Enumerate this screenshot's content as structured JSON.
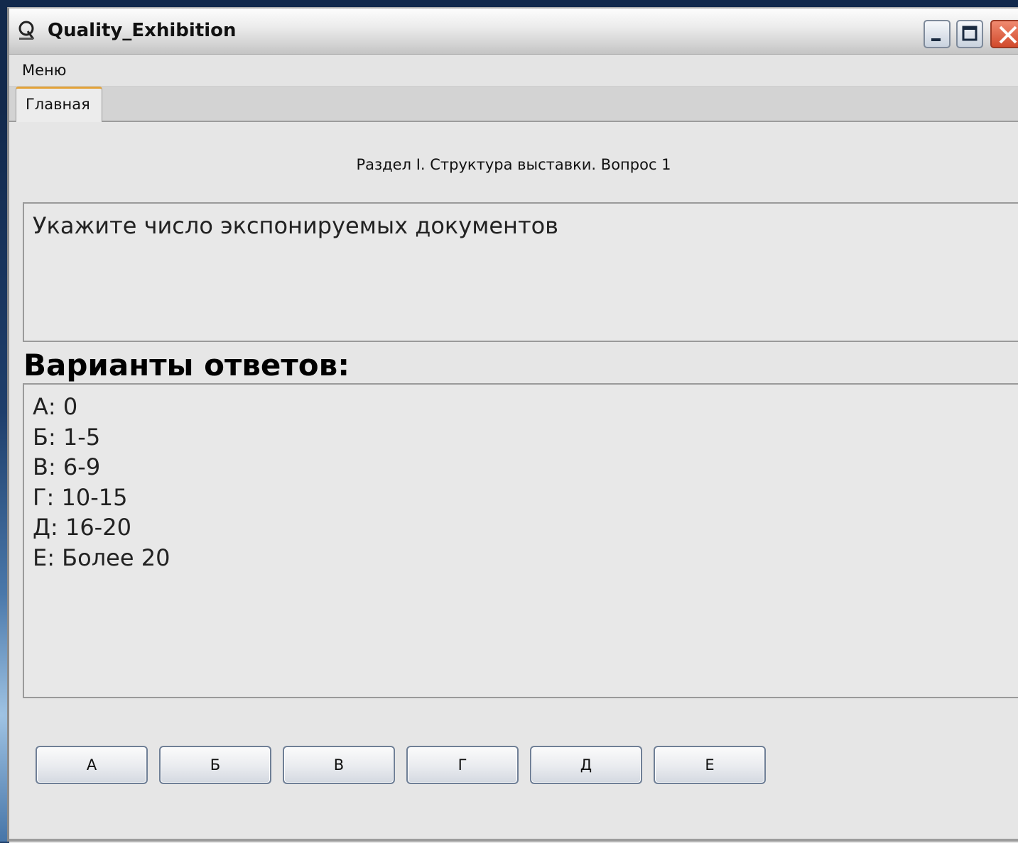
{
  "window": {
    "title": "Quality_Exhibition"
  },
  "menubar": {
    "items": [
      {
        "label": "Меню"
      }
    ]
  },
  "tabs": [
    {
      "label": "Главная",
      "active": true
    }
  ],
  "main": {
    "section_title": "Раздел I. Структура выставки. Вопрос 1",
    "question": "Укажите число экспонируемых документов",
    "answers_heading": "Варианты ответов:",
    "answers": [
      "А: 0",
      "Б: 1-5",
      "В: 6-9",
      "Г: 10-15",
      "Д: 16-20",
      "Е: Более 20"
    ],
    "answer_buttons": [
      {
        "label": "А"
      },
      {
        "label": "Б"
      },
      {
        "label": "В"
      },
      {
        "label": "Г"
      },
      {
        "label": "Д"
      },
      {
        "label": "Е"
      }
    ]
  },
  "colors": {
    "tab_accent": "#e3a33a",
    "close_button": "#d14a2c",
    "window_background": "#e6e6e6"
  }
}
